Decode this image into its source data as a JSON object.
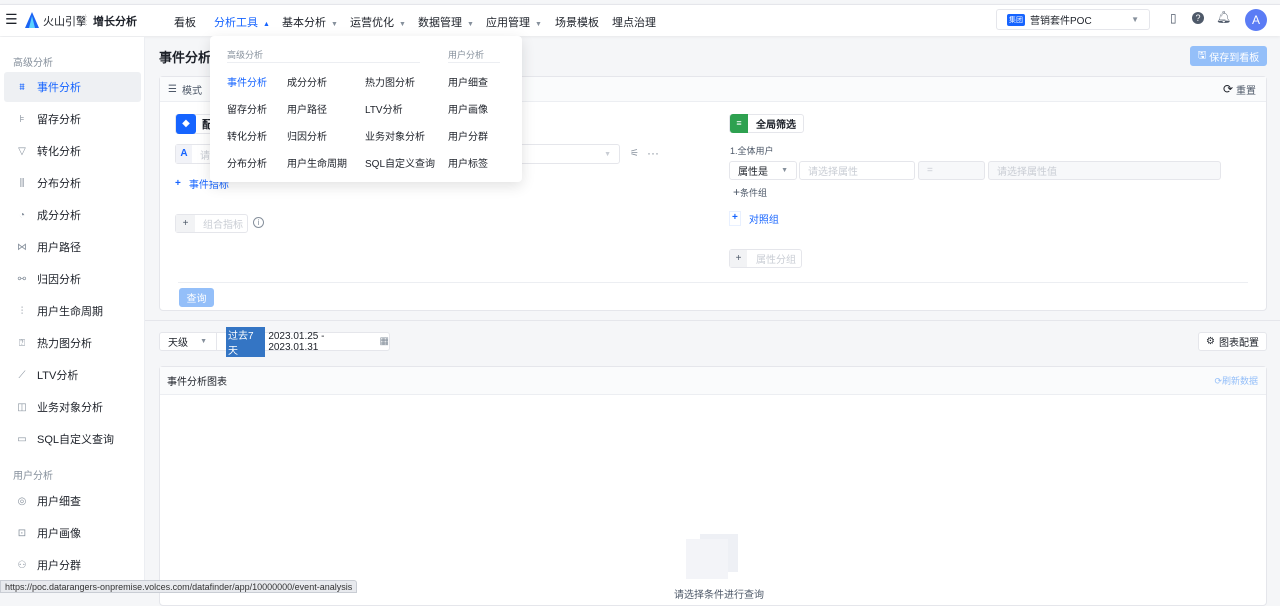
{
  "topbar": {
    "brand": "火山引擎",
    "product": "增长分析",
    "nav": [
      {
        "label": "看板",
        "caret": false
      },
      {
        "label": "分析工具",
        "caret": true,
        "active": true
      },
      {
        "label": "基本分析",
        "caret": true
      },
      {
        "label": "运营优化",
        "caret": true
      },
      {
        "label": "数据管理",
        "caret": true
      },
      {
        "label": "应用管理",
        "caret": true
      },
      {
        "label": "场景模板",
        "caret": false
      },
      {
        "label": "埋点治理",
        "caret": false
      }
    ],
    "project_tag": "集团",
    "project": "营销套件POC",
    "avatar": "A"
  },
  "sidebar": {
    "group1": "高级分析",
    "items1": [
      "事件分析",
      "留存分析",
      "转化分析",
      "分布分析",
      "成分分析",
      "用户路径",
      "归因分析",
      "用户生命周期",
      "热力图分析",
      "LTV分析",
      "业务对象分析",
      "SQL自定义查询"
    ],
    "group2": "用户分析",
    "items2": [
      "用户细查",
      "用户画像",
      "用户分群"
    ]
  },
  "dropdown": {
    "heading1": "高级分析",
    "heading2": "用户分析",
    "cols": [
      [
        "事件分析",
        "留存分析",
        "转化分析",
        "分布分析"
      ],
      [
        "成分分析",
        "用户路径",
        "归因分析",
        "用户生命周期"
      ],
      [
        "热力图分析",
        "LTV分析",
        "业务对象分析",
        "SQL自定义查询"
      ],
      [
        "用户细查",
        "用户画像",
        "用户分群",
        "用户标签"
      ]
    ]
  },
  "main": {
    "title": "事件分析",
    "save": "保存到看板",
    "mode": "模式",
    "reset": "重置",
    "config_chip": "配",
    "row_letter": "A",
    "row_placeholder": "请",
    "add_event_metric": "事件指标",
    "combo_metric": "组合指标",
    "query": "查询",
    "global_filter": "全局筛选",
    "filter_group": "1.全体用户",
    "attr_is": "属性是",
    "attr_placeholder": "请选择属性",
    "op": "=",
    "value_placeholder": "请选择属性值",
    "add_condition": "条件组",
    "compare_group": "对照组",
    "attr_group": "属性分组"
  },
  "toolbar": {
    "granularity": "天级",
    "range_tag": "过去7天",
    "range": "2023.01.25 - 2023.01.31",
    "chart_config": "图表配置"
  },
  "chart": {
    "title": "事件分析图表",
    "refresh": "刷新数据",
    "empty": "请选择条件进行查询"
  },
  "status_url": "https://poc.datarangers-onpremise.volces.com/datafinder/app/10000000/event-analysis",
  "colors": {
    "accent": "#1664ff",
    "green": "#2ea150"
  }
}
